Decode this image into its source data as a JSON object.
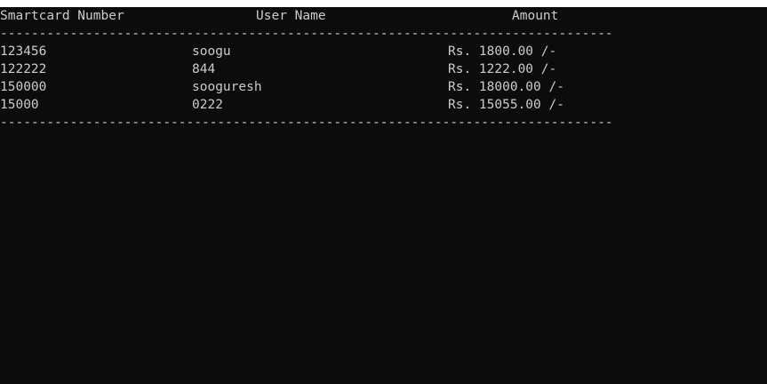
{
  "console": {
    "background": "#0c0c0c",
    "foreground": "#cccccc",
    "headers": {
      "smartcard": "Smartcard Number",
      "username": "User Name",
      "amount": "Amount"
    },
    "separator": "-------------------------------------------------------------------------------",
    "rows": [
      {
        "smartcard": "123456",
        "username": "soogu",
        "amount": "Rs. 1800.00 /-"
      },
      {
        "smartcard": "122222",
        "username": "844",
        "amount": "Rs. 1222.00 /-"
      },
      {
        "smartcard": "150000",
        "username": "sooguresh",
        "amount": "Rs. 18000.00 /-"
      },
      {
        "smartcard": "15000",
        "username": "0222",
        "amount": "Rs. 15055.00 /-"
      }
    ]
  }
}
